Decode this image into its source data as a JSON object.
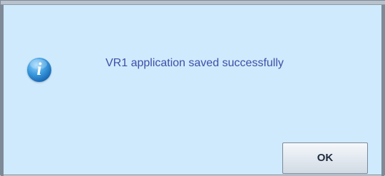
{
  "dialog": {
    "message": "VR1 application saved successfully",
    "icon": "info-icon",
    "ok_label": "OK"
  }
}
